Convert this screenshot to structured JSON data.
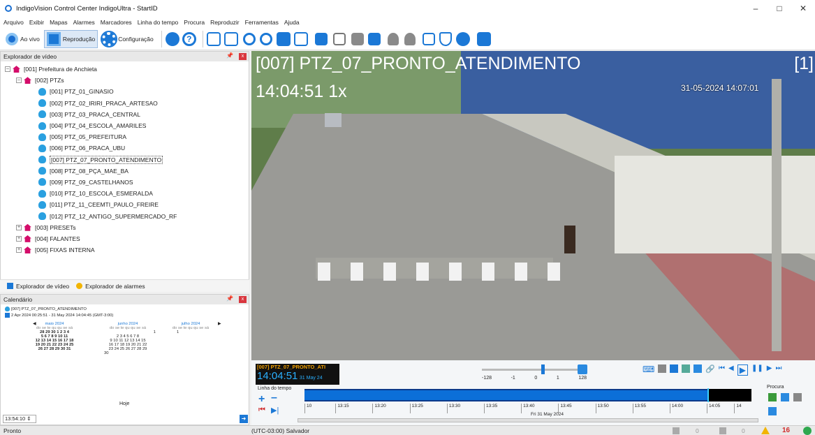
{
  "window": {
    "title": "IndigoVision Control Center IndigoUltra - StartID"
  },
  "menu": [
    "Arquivo",
    "Exibir",
    "Mapas",
    "Alarmes",
    "Marcadores",
    "Linha do tempo",
    "Procura",
    "Reproduzir",
    "Ferramentas",
    "Ajuda"
  ],
  "toolbar": {
    "live_label": "Ao vivo",
    "playback_label": "Reprodução",
    "config_label": "Configuração"
  },
  "explorer": {
    "title": "Explorador de vídeo",
    "root": "[001] Prefeitura de Anchieta",
    "group": "[002] PTZs",
    "cameras": [
      "[001] PTZ_01_GINASIO",
      "[002] PTZ_02_IRIRI_PRACA_ARTESAO",
      "[003] PTZ_03_PRACA_CENTRAL",
      "[004] PTZ_04_ESCOLA_AMARILES",
      "[005] PTZ_05_PREFEITURA",
      "[006] PTZ_06_PRACA_UBU",
      "[007] PTZ_07_PRONTO_ATENDIMENTO",
      "[008] PTZ_08_PÇA_MAE_BA",
      "[009] PTZ_09_CASTELHANOS",
      "[010] PTZ_10_ESCOLA_ESMERALDA",
      "[011] PTZ_11_CEEMTI_PAULO_FREIRE",
      "[012] PTZ_12_ANTIGO_SUPERMERCADO_RF"
    ],
    "others": [
      "[003] PRESETs",
      "[004] FALANTES",
      "[005] FIXAS INTERNA"
    ],
    "tab_video": "Explorador de vídeo",
    "tab_alarms": "Explorador de alarmes"
  },
  "calendar": {
    "title": "Calendário",
    "camera": "[007] PTZ_07_PRONTO_ATENDIMENTO",
    "range": "2 Apr 2024 00:25:51 - 31 May 2024 14:04:45 (GMT-3:00)",
    "months": [
      {
        "name": "maio 2024",
        "weeks": [
          "28 29 30  1  2  3  4",
          "5  6  7  8  9 10 11",
          "12 13 14 15 16 17 18",
          "19 20 21 22 23 24 25",
          "26 27 28 29 30 31"
        ]
      },
      {
        "name": "junho 2024",
        "weeks": [
          "                   1",
          "2  3  4  5  6  7  8",
          "9 10 11 12 13 14 15",
          "16 17 18 19 20 21 22",
          "23 24 25 26 27 28 29",
          "30"
        ]
      },
      {
        "name": "julho 2024",
        "weeks": [
          "1"
        ]
      }
    ],
    "days_header": "do se te qu qu se sá",
    "today_button": "Hoje",
    "time": "13:54:10"
  },
  "video": {
    "name": "[007] PTZ_07_PRONTO_ATENDIMENTO",
    "time": "14:04:51 1x",
    "index": "[1]",
    "timestamp": "31-05-2024 14:07:01"
  },
  "playback": {
    "cam": "[007] PTZ_07_PRONTO_ATI",
    "time": "14:04:51",
    "date": "31 May 24",
    "speed_marks": [
      "-128",
      "-1",
      "0",
      "1",
      "128"
    ],
    "timeline_label": "Linha do tempo",
    "ticks": [
      "10",
      "13:15",
      "13:20",
      "13:25",
      "13:30",
      "13:35",
      "13:40",
      "13:45",
      "13:50",
      "13:55",
      "14:00",
      "14:05",
      "14"
    ],
    "date_label": "Fri 31 May 2024",
    "search_label": "Procura"
  },
  "status": {
    "left": "Pronto",
    "tz": "(UTC-03:00) Salvador",
    "count1": "0",
    "count2": "0",
    "alarms": "16"
  }
}
